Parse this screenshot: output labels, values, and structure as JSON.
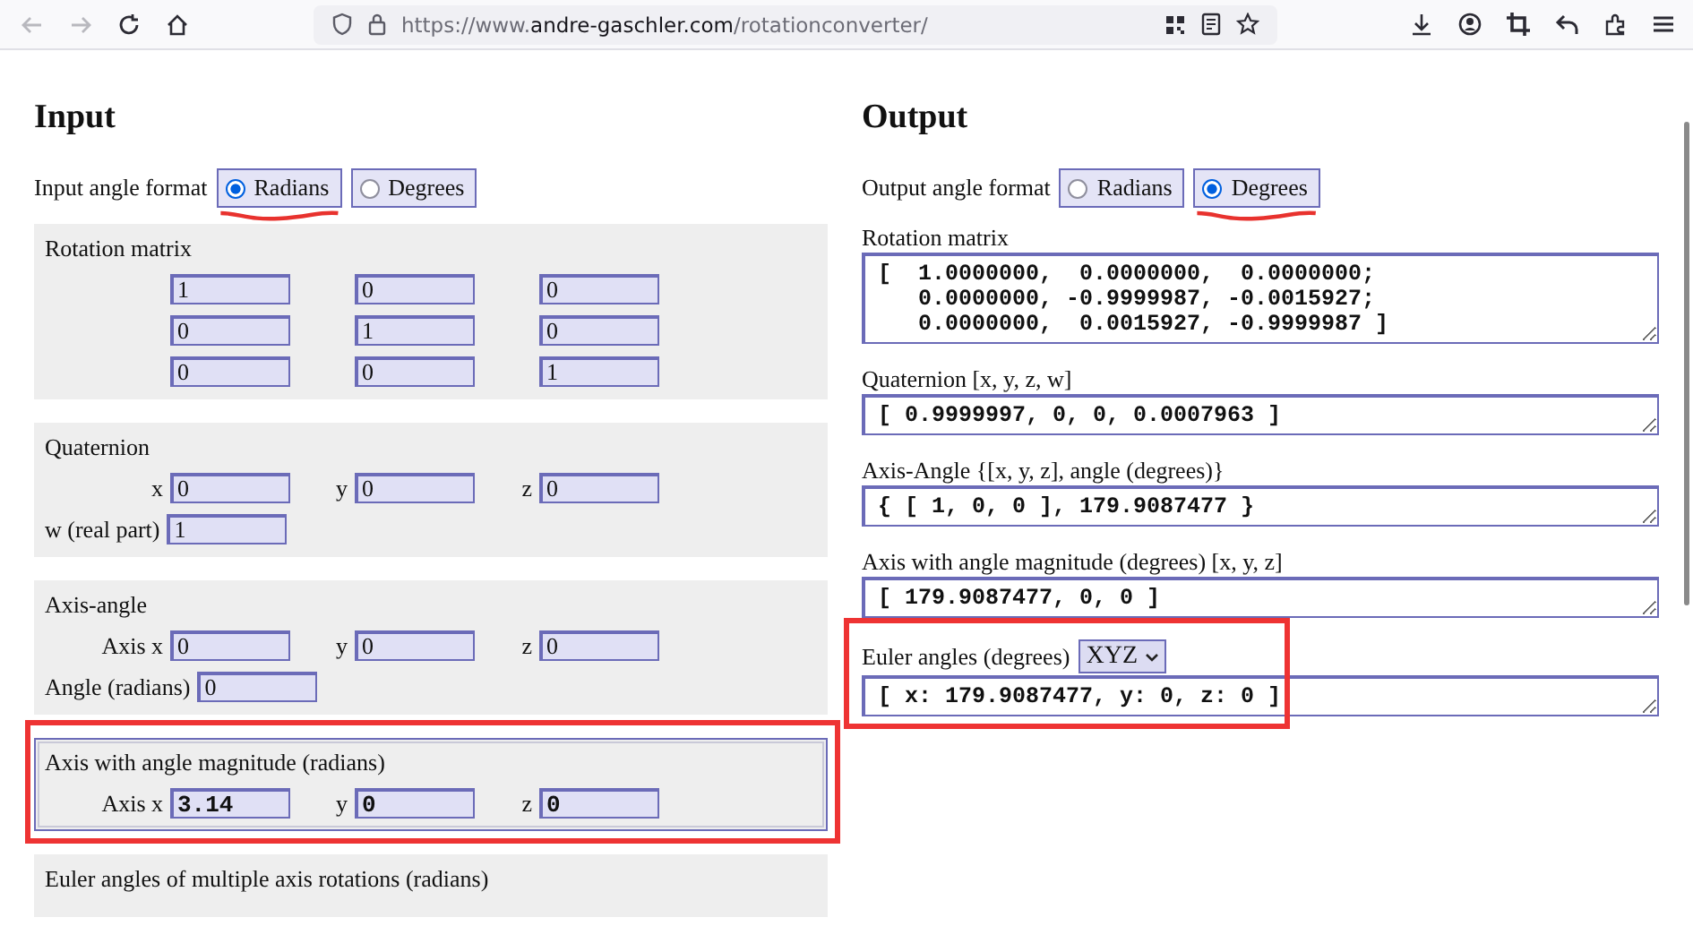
{
  "browser": {
    "url_prefix": "https://www.",
    "url_domain": "andre-gaschler.com",
    "url_path": "/rotationconverter/"
  },
  "input": {
    "title": "Input",
    "format_label": "Input angle format",
    "format_options": [
      {
        "label": "Radians",
        "selected": true,
        "underlined": true
      },
      {
        "label": "Degrees",
        "selected": false,
        "underlined": false
      }
    ],
    "sections": [
      {
        "kind": "matrix",
        "title": "Rotation matrix",
        "active": false,
        "highlighted": false,
        "rows": [
          [
            "1",
            "0",
            "0"
          ],
          [
            "0",
            "1",
            "0"
          ],
          [
            "0",
            "0",
            "1"
          ]
        ]
      },
      {
        "kind": "quaternion",
        "title": "Quaternion",
        "active": false,
        "highlighted": false,
        "fields": [
          {
            "label": "x",
            "value": "0"
          },
          {
            "label": "y",
            "value": "0"
          },
          {
            "label": "z",
            "value": "0"
          }
        ],
        "w_label": "w (real part)",
        "w_value": "1"
      },
      {
        "kind": "axis_angle",
        "title": "Axis-angle",
        "active": false,
        "highlighted": false,
        "fields": [
          {
            "label": "Axis x",
            "value": "0"
          },
          {
            "label": "y",
            "value": "0"
          },
          {
            "label": "z",
            "value": "0"
          }
        ],
        "angle_label": "Angle (radians)",
        "angle_value": "0"
      },
      {
        "kind": "axis_magnitude",
        "title": "Axis with angle magnitude (radians)",
        "active": true,
        "highlighted": true,
        "fields": [
          {
            "label": "Axis x",
            "value": "3.14"
          },
          {
            "label": "y",
            "value": "0"
          },
          {
            "label": "z",
            "value": "0"
          }
        ]
      },
      {
        "kind": "euler",
        "title": "Euler angles of multiple axis rotations (radians)",
        "active": false,
        "highlighted": false
      }
    ]
  },
  "output": {
    "title": "Output",
    "format_label": "Output angle format",
    "format_options": [
      {
        "label": "Radians",
        "selected": false,
        "underlined": false
      },
      {
        "label": "Degrees",
        "selected": true,
        "underlined": true
      }
    ],
    "fields": [
      {
        "label": "Rotation matrix",
        "value": "[  1.0000000,  0.0000000,  0.0000000;\n   0.0000000, -0.9999987, -0.0015927;\n   0.0000000,  0.0015927, -0.9999987 ]",
        "highlighted": false
      },
      {
        "label": "Quaternion [x, y, z, w]",
        "value": "[ 0.9999997, 0, 0, 0.0007963 ]",
        "highlighted": false
      },
      {
        "label": "Axis-Angle {[x, y, z], angle (degrees)}",
        "value": "{ [ 1, 0, 0 ], 179.9087477 }",
        "highlighted": false
      },
      {
        "label": "Axis with angle magnitude (degrees) [x, y, z]",
        "value": "[ 179.9087477, 0, 0 ]",
        "highlighted": false
      },
      {
        "label": "Euler angles (degrees)",
        "select": "XYZ",
        "value": "[ x: 179.9087477, y: 0, z: 0 ]",
        "highlighted": true
      }
    ]
  }
}
